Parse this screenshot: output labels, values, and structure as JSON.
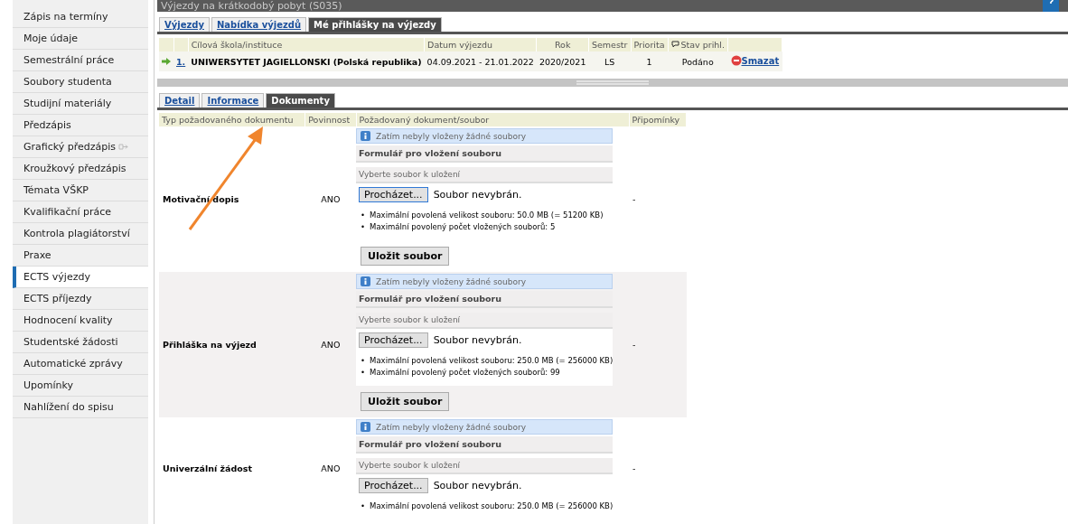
{
  "sidebar": {
    "items": [
      {
        "label": "Zápis na termíny",
        "selected": false,
        "external": false
      },
      {
        "label": "Moje údaje",
        "selected": false,
        "external": false
      },
      {
        "label": "Semestrální práce",
        "selected": false,
        "external": false
      },
      {
        "label": "Soubory studenta",
        "selected": false,
        "external": false
      },
      {
        "label": "Studijní materiály",
        "selected": false,
        "external": false
      },
      {
        "label": "Předzápis",
        "selected": false,
        "external": false
      },
      {
        "label": "Grafický předzápis",
        "selected": false,
        "external": true
      },
      {
        "label": "Kroužkový předzápis",
        "selected": false,
        "external": false
      },
      {
        "label": "Témata VŠKP",
        "selected": false,
        "external": false
      },
      {
        "label": "Kvalifikační práce",
        "selected": false,
        "external": false
      },
      {
        "label": "Kontrola plagiátorství",
        "selected": false,
        "external": false
      },
      {
        "label": "Praxe",
        "selected": false,
        "external": false
      },
      {
        "label": "ECTS výjezdy",
        "selected": true,
        "external": false
      },
      {
        "label": "ECTS příjezdy",
        "selected": false,
        "external": false
      },
      {
        "label": "Hodnocení kvality",
        "selected": false,
        "external": false
      },
      {
        "label": "Studentské žádosti",
        "selected": false,
        "external": false
      },
      {
        "label": "Automatické zprávy",
        "selected": false,
        "external": false
      },
      {
        "label": "Upomínky",
        "selected": false,
        "external": false
      },
      {
        "label": "Nahlížení do spisu",
        "selected": false,
        "external": false
      }
    ]
  },
  "header": {
    "title": "Výjezdy na krátkodobý pobyt (S035)"
  },
  "tabs": [
    {
      "label": "Výjezdy",
      "selected": false
    },
    {
      "label": "Nabídka výjezdů",
      "selected": false
    },
    {
      "label": "Mé přihlášky na výjezdy",
      "selected": true
    }
  ],
  "applications": {
    "columns": [
      "Cílová škola/instituce",
      "Datum výjezdu",
      "Rok",
      "Semestr",
      "Priorita",
      "Stav prihl."
    ],
    "rows": [
      {
        "number": "1.",
        "institution": "UNIWERSYTET JAGIELLONSKI (Polská republika)",
        "dates": "04.09.2021 - 21.01.2022",
        "year": "2020/2021",
        "semester": "LS",
        "priority": "1",
        "status": "Podáno",
        "action": "Smazat"
      }
    ]
  },
  "detail_tabs": [
    {
      "label": "Detail",
      "selected": false
    },
    {
      "label": "Informace",
      "selected": false
    },
    {
      "label": "Dokumenty",
      "selected": true
    }
  ],
  "documents": {
    "columns": [
      "Typ požadovaného dokumentu",
      "Povinnost",
      "Požadovaný dokument/soubor",
      "Připomínky"
    ],
    "rows": [
      {
        "type": "Motivační dopis",
        "required": "ANO",
        "info": "Zatím nebyly vloženy žádné soubory",
        "form_title": "Formulář pro vložení souboru",
        "select_label": "Vyberte soubor k uložení",
        "browse_button": "Procházet...",
        "file_status": "Soubor nevybrán.",
        "focused": true,
        "limits": [
          {
            "bullet": "•",
            "text": "Maximální povolená velikost souboru: 50.0 MB (= 51200 KB)"
          },
          {
            "bullet": "•",
            "text": "Maximální povolený počet vložených souborů: 5"
          }
        ],
        "save_button": "Uložit soubor",
        "notes": "-"
      },
      {
        "type": "Přihláška na výjezd",
        "required": "ANO",
        "info": "Zatím nebyly vloženy žádné soubory",
        "form_title": "Formulář pro vložení souboru",
        "select_label": "Vyberte soubor k uložení",
        "browse_button": "Procházet...",
        "file_status": "Soubor nevybrán.",
        "focused": false,
        "limits": [
          {
            "bullet": "•",
            "text": "Maximální povolená velikost souboru: 250.0 MB (= 256000 KB)"
          },
          {
            "bullet": "•",
            "text": "Maximální povolený počet vložených souborů: 99"
          }
        ],
        "save_button": "Uložit soubor",
        "notes": "-"
      },
      {
        "type": "Univerzální žádost",
        "required": "ANO",
        "info": "Zatím nebyly vloženy žádné soubory",
        "form_title": "Formulář pro vložení souboru",
        "select_label": "Vyberte soubor k uložení",
        "browse_button": "Procházet...",
        "file_status": "Soubor nevybrán.",
        "focused": false,
        "limits": [
          {
            "bullet": "•",
            "text": "Maximální povolená velikost souboru: 250.0 MB (= 256000 KB)"
          }
        ],
        "notes": "-"
      }
    ]
  }
}
